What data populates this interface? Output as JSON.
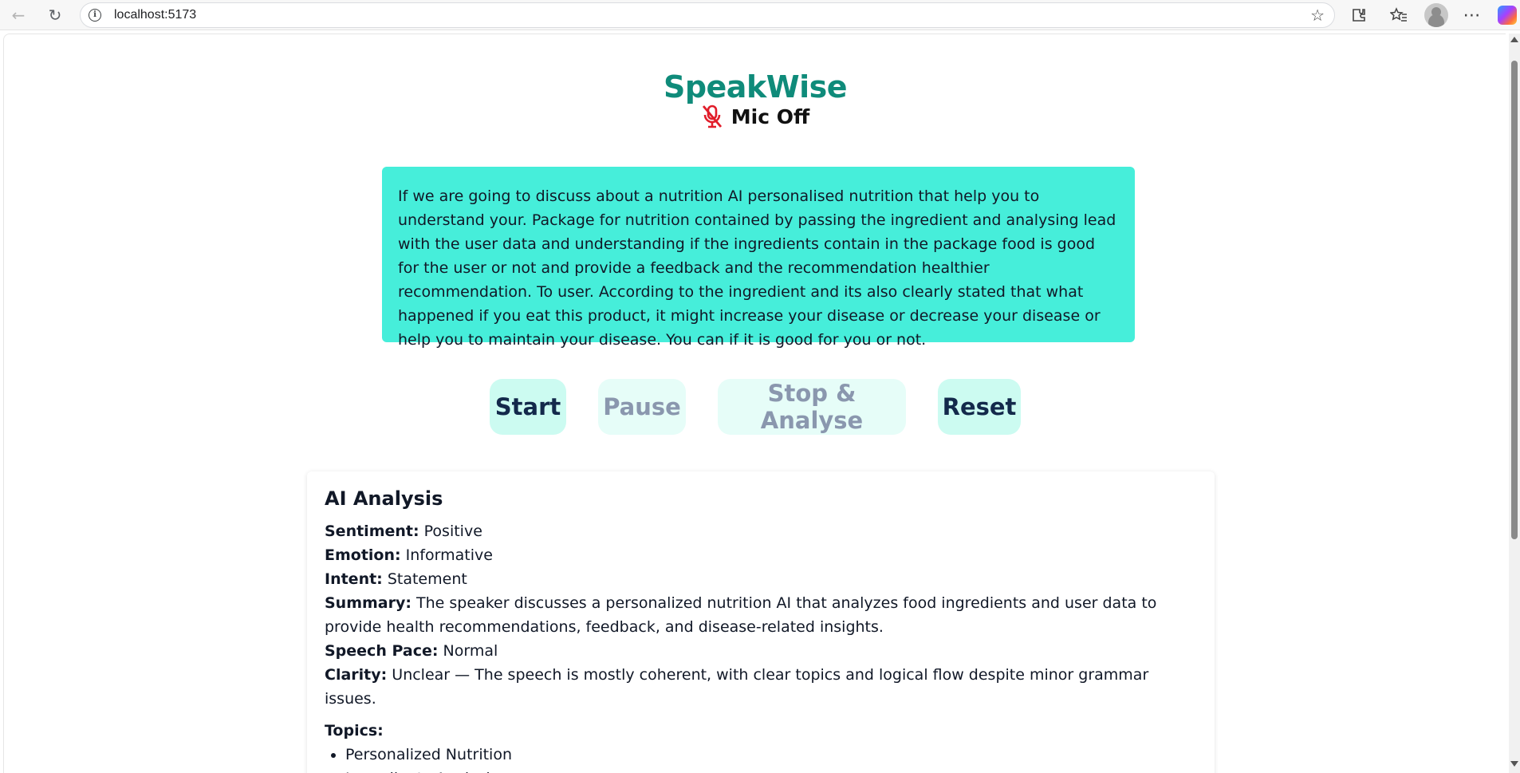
{
  "browser": {
    "url": "localhost:5173"
  },
  "app": {
    "title": "SpeakWise",
    "mic_status": "Mic Off"
  },
  "transcript": "If we are going to discuss about a nutrition AI personalised nutrition that help you to understand your. Package for nutrition contained by passing the ingredient and analysing lead with the user data and understanding if the ingredients contain in the package food is good for the user or not and provide a feedback and the recommendation healthier recommendation. To user. According to the ingredient and its also clearly stated that what happened if you eat this product, it might increase your disease or decrease your disease or help you to maintain your disease. You can if it is good for you or not.",
  "controls": {
    "start": "Start",
    "pause": "Pause",
    "stop": "Stop & Analyse",
    "reset": "Reset"
  },
  "analysis": {
    "title": "AI Analysis",
    "sentiment_label": "Sentiment:",
    "sentiment": "Positive",
    "emotion_label": "Emotion:",
    "emotion": "Informative",
    "intent_label": "Intent:",
    "intent": "Statement",
    "summary_label": "Summary:",
    "summary": "The speaker discusses a personalized nutrition AI that analyzes food ingredients and user data to provide health recommendations, feedback, and disease-related insights.",
    "pace_label": "Speech Pace:",
    "pace": "Normal",
    "clarity_label": "Clarity:",
    "clarity": "Unclear — The speech is mostly coherent, with clear topics and logical flow despite minor grammar issues.",
    "topics_label": "Topics:",
    "topics": [
      "Personalized Nutrition",
      "Ingredients Analysis"
    ]
  },
  "colors": {
    "brand": "#0f8b7a",
    "transcript_bg": "#46eeda",
    "button_bg": "#ccfbf1",
    "mic_off": "#e11d2a"
  },
  "icons": {
    "mic": "mic-off-icon"
  }
}
